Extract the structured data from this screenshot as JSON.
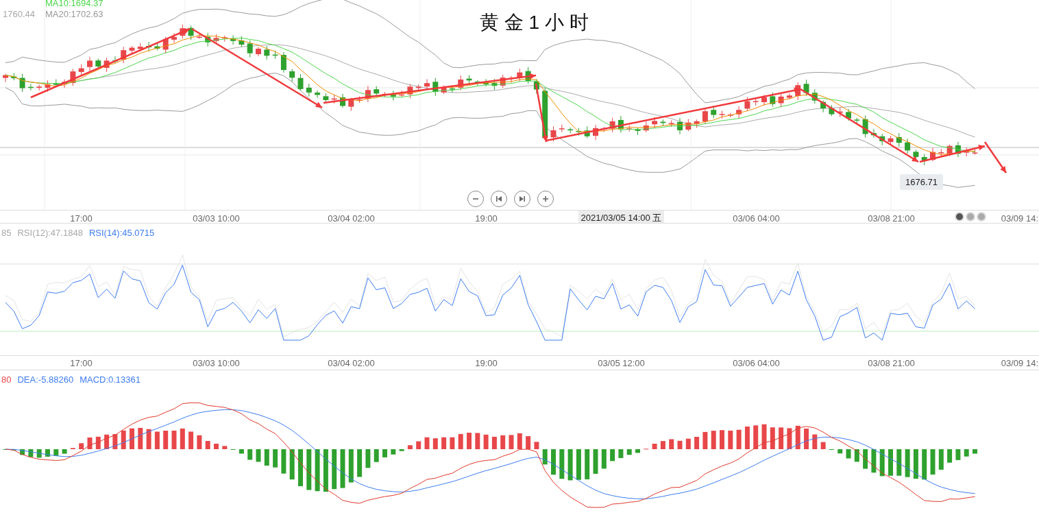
{
  "title": "黄 金 1 小 时",
  "main_chart": {
    "legend": [
      {
        "text": "1760.44",
        "color": "#a8a8a8"
      },
      {
        "text": "MA10:1694.37",
        "color": "#4cd64c"
      },
      {
        "text": "MA20:1702.63",
        "color": "#999999"
      }
    ],
    "controls": [
      {
        "kind": "zoom_out"
      },
      {
        "kind": "previous"
      },
      {
        "kind": "next"
      },
      {
        "kind": "zoom_in"
      }
    ],
    "price_tag": "1676.71"
  },
  "main_axis": {
    "labels": [
      {
        "text": "17:00",
        "highlighted": false
      },
      {
        "text": "03/03 10:00",
        "highlighted": false
      },
      {
        "text": "03/04 02:00",
        "highlighted": false
      },
      {
        "text": "19:00",
        "highlighted": false
      },
      {
        "text": "2021/03/05 14:00 五",
        "highlighted": true
      },
      {
        "text": "03/06 04:00",
        "highlighted": false
      },
      {
        "text": "03/08 21:00",
        "highlighted": false
      },
      {
        "text": "03/09 14:",
        "highlighted": false
      }
    ],
    "pager": [
      {
        "selected": true
      },
      {
        "selected": false
      },
      {
        "selected": false
      }
    ]
  },
  "rsi": {
    "legend": [
      {
        "text": "85",
        "color": "#a8a8a8"
      },
      {
        "text": "RSI(12):47.1848",
        "color": "#a8a8a8"
      },
      {
        "text": "RSI(14):45.0715",
        "color": "#3d7cf0"
      }
    ]
  },
  "rsi_axis": {
    "labels": [
      {
        "text": "17:00",
        "highlighted": false
      },
      {
        "text": "03/03 10:00",
        "highlighted": false
      },
      {
        "text": "03/04 02:00",
        "highlighted": false
      },
      {
        "text": "19:00",
        "highlighted": false
      },
      {
        "text": "03/05 12:00",
        "highlighted": false
      },
      {
        "text": "03/06 04:00",
        "highlighted": false
      },
      {
        "text": "03/08 21:00",
        "highlighted": false
      },
      {
        "text": "03/09 14:",
        "highlighted": false
      }
    ]
  },
  "macd": {
    "legend": [
      {
        "text": "80",
        "color": "#e8474a"
      },
      {
        "text": "DEA:-5.88260",
        "color": "#3d7cf0"
      },
      {
        "text": "MACD:0.13361",
        "color": "#3d7cf0"
      }
    ]
  }
}
